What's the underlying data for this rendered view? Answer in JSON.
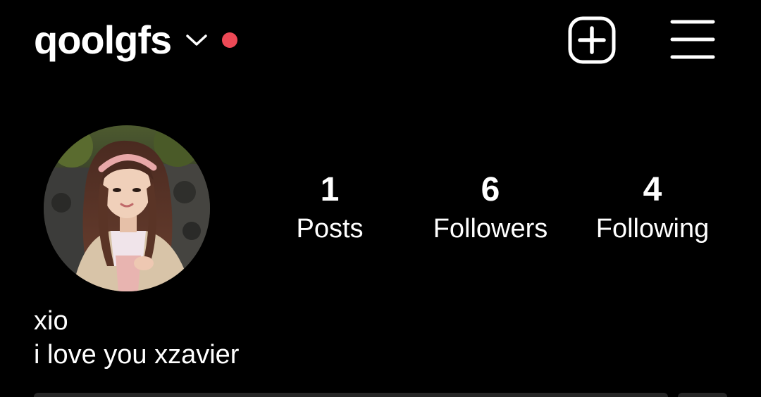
{
  "header": {
    "username": "qoolgfs",
    "switcher_icon": "chevron-down-icon",
    "notification_color": "#ed4956",
    "new_post_icon": "plus-square-icon",
    "menu_icon": "hamburger-menu-icon"
  },
  "profile": {
    "avatar_icon": "profile-photo",
    "stats": [
      {
        "count": "1",
        "label": "Posts"
      },
      {
        "count": "6",
        "label": "Followers"
      },
      {
        "count": "4",
        "label": "Following"
      }
    ],
    "display_name": "xio",
    "bio": "i love you xzavier"
  },
  "colors": {
    "background": "#000000",
    "text": "#ffffff",
    "notification": "#ed4956",
    "button_bg": "#262626"
  }
}
